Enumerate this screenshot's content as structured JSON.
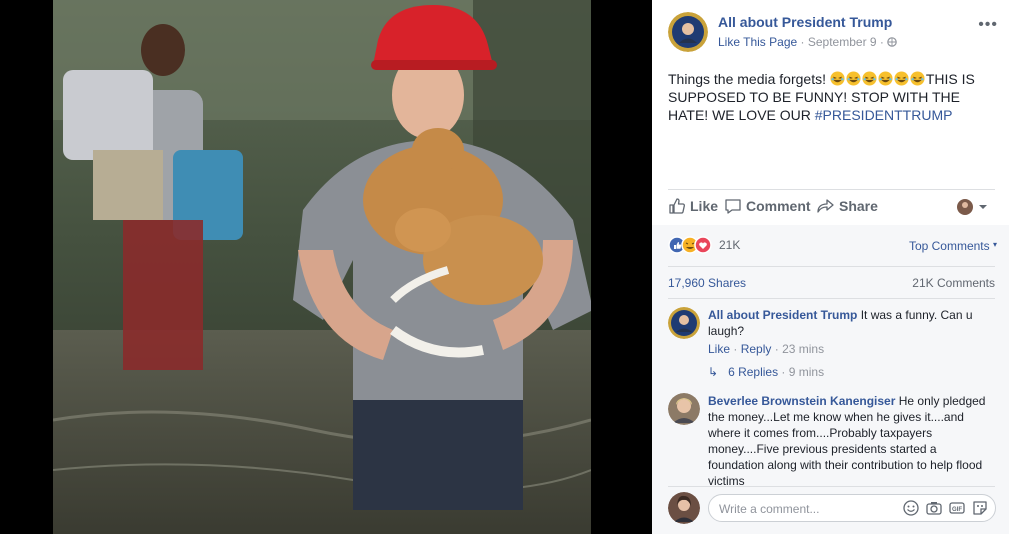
{
  "post": {
    "page_name": "All about President Trump",
    "like_page": "Like This Page",
    "date": "September 9",
    "text_before": "Things the media forgets! ",
    "emoji_count": 6,
    "text_after": "THIS IS SUPPOSED TO BE FUNNY! STOP WITH THE HATE! WE LOVE OUR ",
    "hashtag": "#PRESIDENTTRUMP"
  },
  "actions": {
    "like": "Like",
    "comment": "Comment",
    "share": "Share"
  },
  "reactions": {
    "count": "21K",
    "top_comments": "Top Comments"
  },
  "stats": {
    "shares": "17,960 Shares",
    "comments": "21K Comments"
  },
  "comments": [
    {
      "author": "All about President Trump",
      "text": "It was a funny. Can u laugh?",
      "like": "Like",
      "reply": "Reply",
      "time": "23 mins",
      "replies_label": "6 Replies",
      "replies_time": "9 mins"
    },
    {
      "author": "Beverlee Brownstein Kanengiser",
      "text": "He only pledged the money...Let me know when he gives it....and where it comes from....Probably taxpayers money....Five previous presidents started a foundation along with their contribution to help flood victims"
    }
  ],
  "composer": {
    "placeholder": "Write a comment..."
  },
  "colors": {
    "link": "#365899",
    "muted": "#90949c",
    "like_blue": "#4267b2",
    "hat_red": "#d8222a"
  }
}
